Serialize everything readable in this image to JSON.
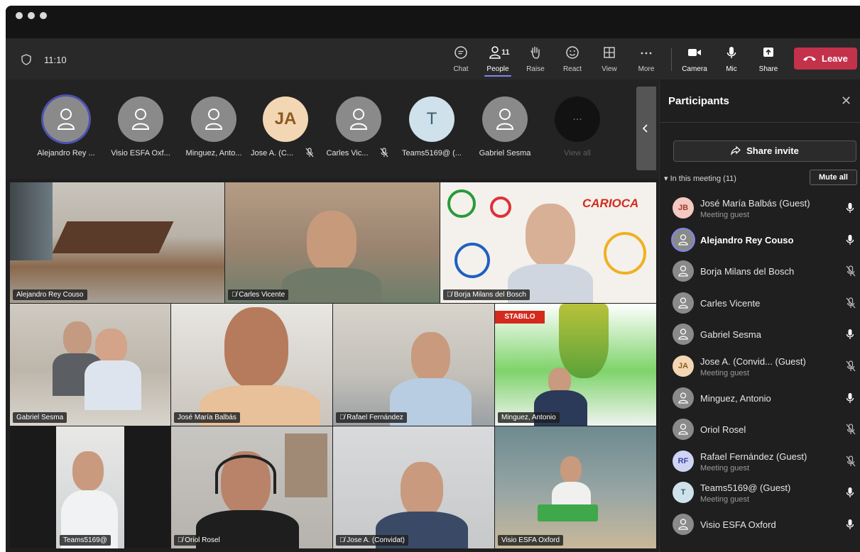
{
  "window": {
    "time": "11:10"
  },
  "toolbar": {
    "chat": "Chat",
    "people": "People",
    "people_count": "11",
    "raise": "Raise",
    "react": "React",
    "view": "View",
    "more": "More",
    "camera": "Camera",
    "mic": "Mic",
    "share": "Share",
    "leave": "Leave"
  },
  "avatar_strip": [
    {
      "name": "Alejandro Rey ...",
      "initials": "",
      "muted": false,
      "selected": true
    },
    {
      "name": "Visio ESFA Oxf...",
      "initials": "",
      "muted": false
    },
    {
      "name": "Minguez, Anto...",
      "initials": "",
      "muted": false
    },
    {
      "name": "Jose A. (C...",
      "initials": "JA",
      "muted": true
    },
    {
      "name": "Carles Vic...",
      "initials": "",
      "muted": true
    },
    {
      "name": "Teams5169@ (...",
      "initials": "T",
      "muted": false
    },
    {
      "name": "Gabriel Sesma",
      "initials": "",
      "muted": false
    },
    {
      "name": "View all",
      "initials": "...",
      "muted": false
    }
  ],
  "video_tiles": [
    {
      "name": "Alejandro Rey Couso",
      "muted": false
    },
    {
      "name": "Carles Vicente",
      "muted": true
    },
    {
      "name": "Borja Milans del Bosch",
      "muted": true
    },
    {
      "name": "Gabriel Sesma",
      "muted": false
    },
    {
      "name": "José María Balbás",
      "muted": false
    },
    {
      "name": "Rafael Fernández",
      "muted": true
    },
    {
      "name": "Minguez, Antonio",
      "muted": false
    },
    {
      "name": "Teams5169@",
      "muted": false
    },
    {
      "name": "Oriol Rosel",
      "muted": true
    },
    {
      "name": "Jose A. (Convidat)",
      "muted": true
    },
    {
      "name": "Visio ESFA Oxford",
      "muted": false
    }
  ],
  "tile_text": {
    "carioca": "CARIOCA",
    "stabilo": "STABILO"
  },
  "panel": {
    "title": "Participants",
    "share_invite": "Share invite",
    "in_meeting": "In this meeting (11)",
    "mute_all": "Mute all",
    "participants": [
      {
        "name": "José María Balbás (Guest)",
        "sub": "Meeting guest",
        "initials": "JB",
        "avatar_color": "#f4c9c2",
        "text_color": "#a33a2e",
        "muted": false,
        "bold": false
      },
      {
        "name": "Alejandro Rey Couso",
        "sub": "",
        "initials": "",
        "avatar_color": "#8a8a8a",
        "muted": false,
        "bold": true
      },
      {
        "name": "Borja Milans del Bosch",
        "sub": "",
        "initials": "",
        "avatar_color": "#8a8a8a",
        "muted": true,
        "bold": false
      },
      {
        "name": "Carles Vicente",
        "sub": "",
        "initials": "",
        "avatar_color": "#8a8a8a",
        "muted": true,
        "bold": false
      },
      {
        "name": "Gabriel Sesma",
        "sub": "",
        "initials": "",
        "avatar_color": "#8a8a8a",
        "muted": false,
        "bold": false
      },
      {
        "name": "Jose A. (Convid...  (Guest)",
        "sub": "Meeting guest",
        "initials": "JA",
        "avatar_color": "#f3d6b4",
        "text_color": "#8c5a1e",
        "muted": true,
        "bold": false
      },
      {
        "name": "Minguez, Antonio",
        "sub": "",
        "initials": "",
        "avatar_color": "#8a8a8a",
        "muted": false,
        "bold": false
      },
      {
        "name": "Oriol Rosel",
        "sub": "",
        "initials": "",
        "avatar_color": "#8a8a8a",
        "muted": true,
        "bold": false
      },
      {
        "name": "Rafael Fernández (Guest)",
        "sub": "Meeting guest",
        "initials": "RF",
        "avatar_color": "#cfd3f4",
        "text_color": "#3d43a3",
        "muted": true,
        "bold": false
      },
      {
        "name": "Teams5169@ (Guest)",
        "sub": "Meeting guest",
        "initials": "T",
        "avatar_color": "#cfe1ea",
        "text_color": "#3b5f72",
        "muted": false,
        "bold": false
      },
      {
        "name": "Visio ESFA Oxford",
        "sub": "",
        "initials": "",
        "avatar_color": "#8a8a8a",
        "muted": false,
        "bold": false
      }
    ]
  },
  "colors": {
    "accent": "#7f85f5",
    "leave": "#c4314b",
    "background": "#1f1f1f"
  }
}
